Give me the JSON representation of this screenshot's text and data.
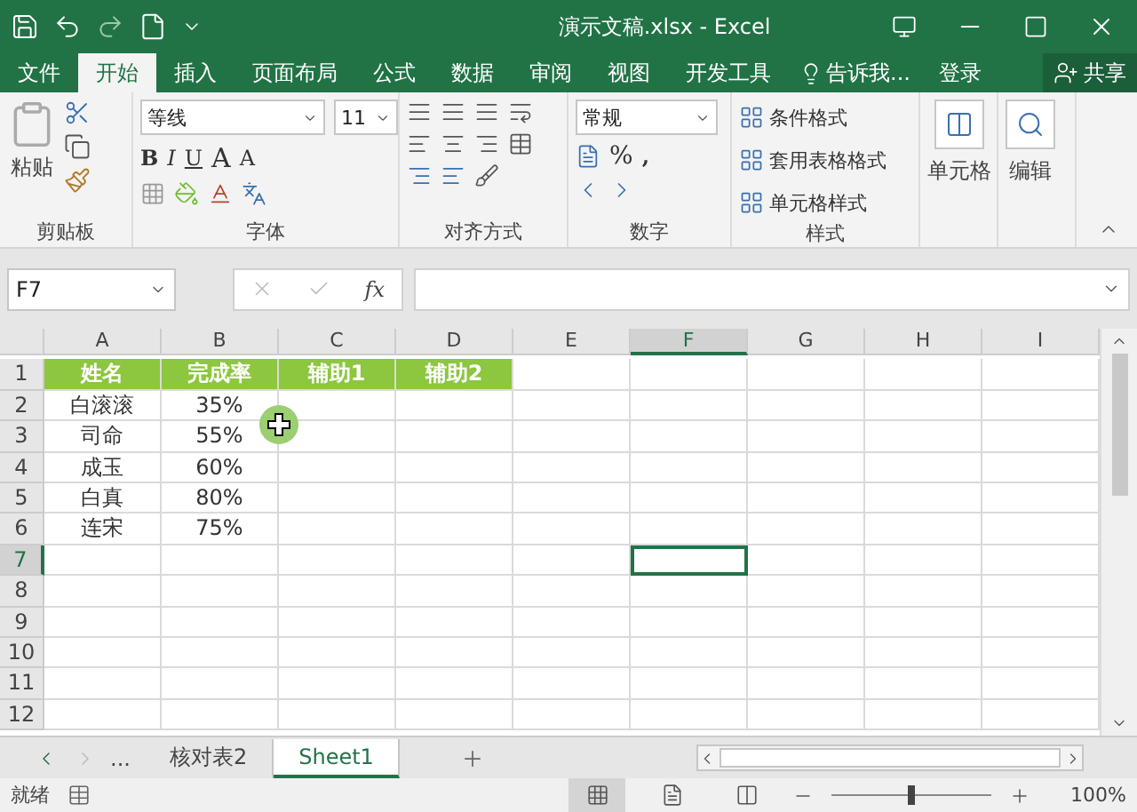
{
  "window": {
    "title": "演示文稿.xlsx - Excel"
  },
  "ribbon_tabs": [
    {
      "label": "文件",
      "selected": false
    },
    {
      "label": "开始",
      "selected": true
    },
    {
      "label": "插入",
      "selected": false
    },
    {
      "label": "页面布局",
      "selected": false
    },
    {
      "label": "公式",
      "selected": false
    },
    {
      "label": "数据",
      "selected": false
    },
    {
      "label": "审阅",
      "selected": false
    },
    {
      "label": "视图",
      "selected": false
    },
    {
      "label": "开发工具",
      "selected": false
    }
  ],
  "tell_me": "告诉我...",
  "sign_in": "登录",
  "share": "共享",
  "clipboard": {
    "paste": "粘贴",
    "label": "剪贴板"
  },
  "font": {
    "name": "等线",
    "size": "11",
    "bold": "B",
    "italic": "I",
    "underline": "U",
    "grow": "A",
    "shrink": "A",
    "label": "字体"
  },
  "alignment": {
    "label": "对齐方式"
  },
  "number": {
    "format": "常规",
    "percent": "%",
    "comma": ",",
    "label": "数字"
  },
  "styles": {
    "items": [
      "条件格式",
      "套用表格格式",
      "单元格样式"
    ],
    "label": "样式"
  },
  "cells": {
    "label": "单元格"
  },
  "editing": {
    "label": "编辑"
  },
  "formula_bar": {
    "name_box": "F7",
    "fx": "fx"
  },
  "columns": [
    {
      "label": "A",
      "selected": false
    },
    {
      "label": "B",
      "selected": false
    },
    {
      "label": "C",
      "selected": false
    },
    {
      "label": "D",
      "selected": false
    },
    {
      "label": "E",
      "selected": false
    },
    {
      "label": "F",
      "selected": true
    },
    {
      "label": "G",
      "selected": false
    },
    {
      "label": "H",
      "selected": false
    },
    {
      "label": "I",
      "selected": false
    }
  ],
  "rows": [
    {
      "number": "1",
      "kind": "header",
      "selected": false,
      "cells": [
        "姓名",
        "完成率",
        "辅助1",
        "辅助2"
      ]
    },
    {
      "number": "2",
      "kind": "data",
      "selected": false,
      "cells": [
        "白滚滚",
        "35%"
      ]
    },
    {
      "number": "3",
      "kind": "data",
      "selected": false,
      "cells": [
        "司命",
        "55%"
      ]
    },
    {
      "number": "4",
      "kind": "data",
      "selected": false,
      "cells": [
        "成玉",
        "60%"
      ]
    },
    {
      "number": "5",
      "kind": "data",
      "selected": false,
      "cells": [
        "白真",
        "80%"
      ]
    },
    {
      "number": "6",
      "kind": "data",
      "selected": false,
      "cells": [
        "连宋",
        "75%"
      ]
    },
    {
      "number": "7",
      "kind": "data",
      "selected": true,
      "cells": []
    },
    {
      "number": "8",
      "kind": "data",
      "selected": false,
      "cells": []
    },
    {
      "number": "9",
      "kind": "data",
      "selected": false,
      "cells": []
    },
    {
      "number": "10",
      "kind": "data",
      "selected": false,
      "cells": []
    },
    {
      "number": "11",
      "kind": "data",
      "selected": false,
      "cells": []
    },
    {
      "number": "12",
      "kind": "data",
      "selected": false,
      "cells": []
    }
  ],
  "more_sheets": "...",
  "sheet_tabs": [
    {
      "label": "核对表2",
      "selected": false
    },
    {
      "label": "Sheet1",
      "selected": true
    }
  ],
  "status": {
    "text": "就绪",
    "zoom": "100%",
    "zoom_slider": {
      "level": 0.5
    }
  }
}
